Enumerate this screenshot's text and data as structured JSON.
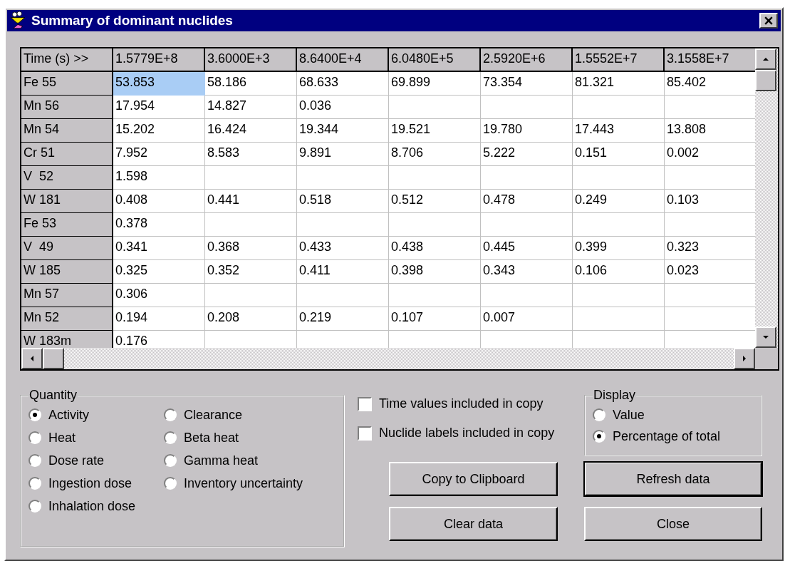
{
  "window": {
    "title": "Summary of dominant nuclides"
  },
  "table": {
    "corner": "Time (s) >>",
    "columns": [
      "1.5779E+8",
      "3.6000E+3",
      "8.6400E+4",
      "6.0480E+5",
      "2.5920E+6",
      "1.5552E+7",
      "3.1558E+7"
    ],
    "rows": [
      {
        "label": "Fe 55",
        "cells": [
          {
            "value": "53.853",
            "selected": true
          },
          {
            "value": "58.186",
            "selected": false
          },
          {
            "value": "68.633",
            "selected": false
          },
          {
            "value": "69.899",
            "selected": false
          },
          {
            "value": "73.354",
            "selected": false
          },
          {
            "value": "81.321",
            "selected": false
          },
          {
            "value": "85.402",
            "selected": false
          }
        ]
      },
      {
        "label": "Mn 56",
        "cells": [
          {
            "value": "17.954",
            "selected": false
          },
          {
            "value": "14.827",
            "selected": false
          },
          {
            "value": "0.036",
            "selected": false
          },
          {
            "selected": false
          },
          {
            "selected": false
          },
          {
            "selected": false
          },
          {
            "selected": false
          }
        ]
      },
      {
        "label": "Mn 54",
        "cells": [
          {
            "value": "15.202",
            "selected": false
          },
          {
            "value": "16.424",
            "selected": false
          },
          {
            "value": "19.344",
            "selected": false
          },
          {
            "value": "19.521",
            "selected": false
          },
          {
            "value": "19.780",
            "selected": false
          },
          {
            "value": "17.443",
            "selected": false
          },
          {
            "value": "13.808",
            "selected": false
          }
        ]
      },
      {
        "label": "Cr 51",
        "cells": [
          {
            "value": "7.952",
            "selected": false
          },
          {
            "value": "8.583",
            "selected": false
          },
          {
            "value": "9.891",
            "selected": false
          },
          {
            "value": "8.706",
            "selected": false
          },
          {
            "value": "5.222",
            "selected": false
          },
          {
            "value": "0.151",
            "selected": false
          },
          {
            "value": "0.002",
            "selected": false
          }
        ]
      },
      {
        "label": "V  52",
        "cells": [
          {
            "value": "1.598",
            "selected": false
          },
          {
            "selected": false
          },
          {
            "selected": false
          },
          {
            "selected": false
          },
          {
            "selected": false
          },
          {
            "selected": false
          },
          {
            "selected": false
          }
        ]
      },
      {
        "label": "W 181",
        "cells": [
          {
            "value": "0.408",
            "selected": false
          },
          {
            "value": "0.441",
            "selected": false
          },
          {
            "value": "0.518",
            "selected": false
          },
          {
            "value": "0.512",
            "selected": false
          },
          {
            "value": "0.478",
            "selected": false
          },
          {
            "value": "0.249",
            "selected": false
          },
          {
            "value": "0.103",
            "selected": false
          }
        ]
      },
      {
        "label": "Fe 53",
        "cells": [
          {
            "value": "0.378",
            "selected": false
          },
          {
            "selected": false
          },
          {
            "selected": false
          },
          {
            "selected": false
          },
          {
            "selected": false
          },
          {
            "selected": false
          },
          {
            "selected": false
          }
        ]
      },
      {
        "label": "V  49",
        "cells": [
          {
            "value": "0.341",
            "selected": false
          },
          {
            "value": "0.368",
            "selected": false
          },
          {
            "value": "0.433",
            "selected": false
          },
          {
            "value": "0.438",
            "selected": false
          },
          {
            "value": "0.445",
            "selected": false
          },
          {
            "value": "0.399",
            "selected": false
          },
          {
            "value": "0.323",
            "selected": false
          }
        ]
      },
      {
        "label": "W 185",
        "cells": [
          {
            "value": "0.325",
            "selected": false
          },
          {
            "value": "0.352",
            "selected": false
          },
          {
            "value": "0.411",
            "selected": false
          },
          {
            "value": "0.398",
            "selected": false
          },
          {
            "value": "0.343",
            "selected": false
          },
          {
            "value": "0.106",
            "selected": false
          },
          {
            "value": "0.023",
            "selected": false
          }
        ]
      },
      {
        "label": "Mn 57",
        "cells": [
          {
            "value": "0.306",
            "selected": false
          },
          {
            "selected": false
          },
          {
            "selected": false
          },
          {
            "selected": false
          },
          {
            "selected": false
          },
          {
            "selected": false
          },
          {
            "selected": false
          }
        ]
      },
      {
        "label": "Mn 52",
        "cells": [
          {
            "value": "0.194",
            "selected": false
          },
          {
            "value": "0.208",
            "selected": false
          },
          {
            "value": "0.219",
            "selected": false
          },
          {
            "value": "0.107",
            "selected": false
          },
          {
            "value": "0.007",
            "selected": false
          },
          {
            "selected": false
          },
          {
            "selected": false
          }
        ]
      },
      {
        "label": "W 183m",
        "cells": [
          {
            "value": "0.176",
            "selected": false
          },
          {
            "selected": false
          },
          {
            "selected": false
          },
          {
            "selected": false
          },
          {
            "selected": false
          },
          {
            "selected": false
          },
          {
            "selected": false
          }
        ]
      }
    ]
  },
  "quantity": {
    "title": "Quantity",
    "options": [
      {
        "label": "Activity",
        "selected": true
      },
      {
        "label": "Clearance",
        "selected": false
      },
      {
        "label": "Heat",
        "selected": false
      },
      {
        "label": "Beta heat",
        "selected": false
      },
      {
        "label": "Dose rate",
        "selected": false
      },
      {
        "label": "Gamma heat",
        "selected": false
      },
      {
        "label": "Ingestion dose",
        "selected": false
      },
      {
        "label": "Inventory uncertainty",
        "selected": false
      },
      {
        "label": "Inhalation dose",
        "selected": false
      }
    ]
  },
  "copy_options": [
    {
      "label": "Time values included in copy",
      "checked": false
    },
    {
      "label": "Nuclide labels included in copy",
      "checked": false
    }
  ],
  "display": {
    "title": "Display",
    "options": [
      {
        "label": "Value",
        "selected": false
      },
      {
        "label": "Percentage of total",
        "selected": true
      }
    ]
  },
  "buttons": [
    {
      "label": "Copy to Clipboard",
      "default": false
    },
    {
      "label": "Refresh data",
      "default": true
    },
    {
      "label": "Clear data",
      "default": false
    },
    {
      "label": "Close",
      "default": false
    }
  ]
}
